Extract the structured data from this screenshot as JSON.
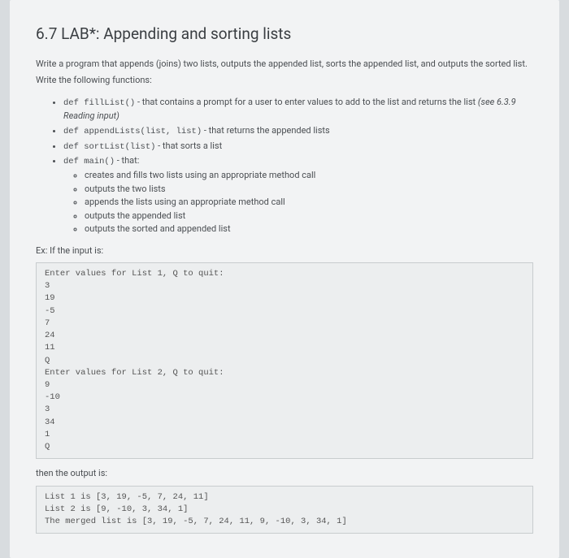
{
  "title": "6.7 LAB*: Appending and sorting lists",
  "intro": "Write a program that appends (joins) two lists, outputs the appended list, sorts the appended list, and outputs the sorted list.",
  "subintro": "Write the following functions:",
  "bullets": {
    "b1_code": "def fillList()",
    "b1_text": " - that contains a prompt for a user to enter values to add to the list and returns the list ",
    "b1_ref": "(see 6.3.9 Reading input)",
    "b2_code": "def appendLists(list, list)",
    "b2_text": " - that returns the appended lists",
    "b3_code": "def sortList(list)",
    "b3_text": " - that sorts a list",
    "b4_code": "def main()",
    "b4_text": " - that:",
    "sub": {
      "s1": "creates and fills two lists using an appropriate method call",
      "s2": "outputs the two lists",
      "s3": "appends the lists using an appropriate method call",
      "s4": "outputs the appended list",
      "s5": "outputs the sorted and appended list"
    }
  },
  "ex_label": "Ex: If the input is:",
  "input_block": "Enter values for List 1, Q to quit:\n3\n19\n-5\n7\n24\n11\nQ\nEnter values for List 2, Q to quit:\n9\n-10\n3\n34\n1\nQ",
  "then_label": "then the output is:",
  "output_block": "List 1 is [3, 19, -5, 7, 24, 11]\nList 2 is [9, -10, 3, 34, 1]\nThe merged list is [3, 19, -5, 7, 24, 11, 9, -10, 3, 34, 1]"
}
